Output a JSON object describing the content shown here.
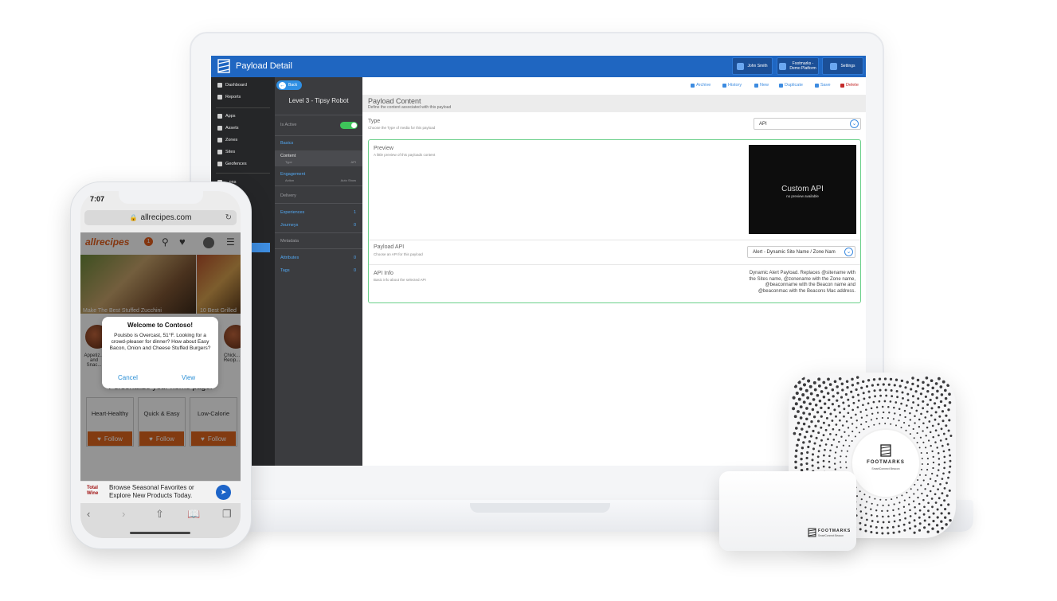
{
  "app": {
    "title": "Payload Detail",
    "user_button": "John Smith",
    "org_button_line1": "Footmarks -",
    "org_button_line2": "Demo Platform",
    "settings_button": "Settings"
  },
  "sidebar": {
    "items": [
      {
        "label": "Dashboard",
        "icon": "dashboard-icon"
      },
      {
        "label": "Reports",
        "icon": "chart-icon"
      },
      {
        "label": "Apps",
        "icon": "phone-icon"
      },
      {
        "label": "Assets",
        "icon": "asterisk-icon"
      },
      {
        "label": "Zones",
        "icon": "grid-icon"
      },
      {
        "label": "Sites",
        "icon": "pin-icon"
      },
      {
        "label": "Geofences",
        "icon": "target-icon"
      },
      {
        "label": "...ons",
        "icon": "beacon-icon"
      }
    ]
  },
  "panel": {
    "back_label": "Back",
    "title": "Level 3 - Tipsy Robot",
    "is_active_label": "Is Active",
    "is_active": true,
    "basics": "Basics",
    "content": "Content",
    "content_type_label": "Type",
    "content_type_value": "API",
    "engagement": "Engagement",
    "engagement_action_label": "Action",
    "engagement_action_value": "Auto Show",
    "delivery": "Delivery",
    "experiences": "Experiences",
    "experiences_count": "1",
    "journeys": "Journeys",
    "journeys_count": "0",
    "metadata": "Metadata",
    "attributes": "Attributes",
    "attributes_count": "0",
    "tags": "Tags",
    "tags_count": "0"
  },
  "toolbar": {
    "archive": "Archive",
    "history": "History",
    "new": "New",
    "duplicate": "Duplicate",
    "save": "Save",
    "delete": "Delete"
  },
  "payload": {
    "section_title": "Payload Content",
    "section_sub": "Define the content associated with this payload",
    "type_label": "Type",
    "type_sub": "Choose the Type of media for this payload",
    "type_value": "API",
    "preview_label": "Preview",
    "preview_sub": "A little preview of this payloads content",
    "preview_title": "Custom API",
    "preview_note": "no preview available",
    "api_label": "Payload API",
    "api_sub": "Choose an API for this payload",
    "api_value": "Alert - Dynamic Site Name / Zone Nam",
    "info_label": "API Info",
    "info_sub": "Basic info about the selected API",
    "info_text": "Dynamic Alert Payload. Replaces @sitename with the Sites name, @zonename with the Zone name, @beaconname with the Beacon name and @beaconmac with the Beacons Mac address."
  },
  "beacons": {
    "brand": "FOOTMARKS",
    "sub": "SmartConnect Beacon"
  },
  "phone": {
    "time": "7:07",
    "url": "allrecipes.com",
    "logo": "allrecipes",
    "notif_count": "1",
    "food_caption_1": "Make The Best Stuffed Zucchini",
    "food_caption_2": "10 Best Grilled",
    "cat_left": "Appetiz... and Snac...",
    "cat_right": "Chick... Recip...",
    "personalize": "Personalize your home page!",
    "cards": [
      {
        "label": "Heart-Healthy",
        "follow": "Follow"
      },
      {
        "label": "Quick & Easy",
        "follow": "Follow"
      },
      {
        "label": "Low-Calorie",
        "follow": "Follow"
      }
    ],
    "ad_line1": "Browse Seasonal Favorites or",
    "ad_line2": "Explore New Products Today.",
    "ad_brand": "Total Wine",
    "modal": {
      "title": "Welcome to Contoso!",
      "body": "Poulsbo is Overcast, 51°F. Looking for a crowd-pleaser for dinner? How about Easy Bacon, Onion and Cheese Stuffed Burgers?",
      "cancel": "Cancel",
      "view": "View"
    }
  }
}
